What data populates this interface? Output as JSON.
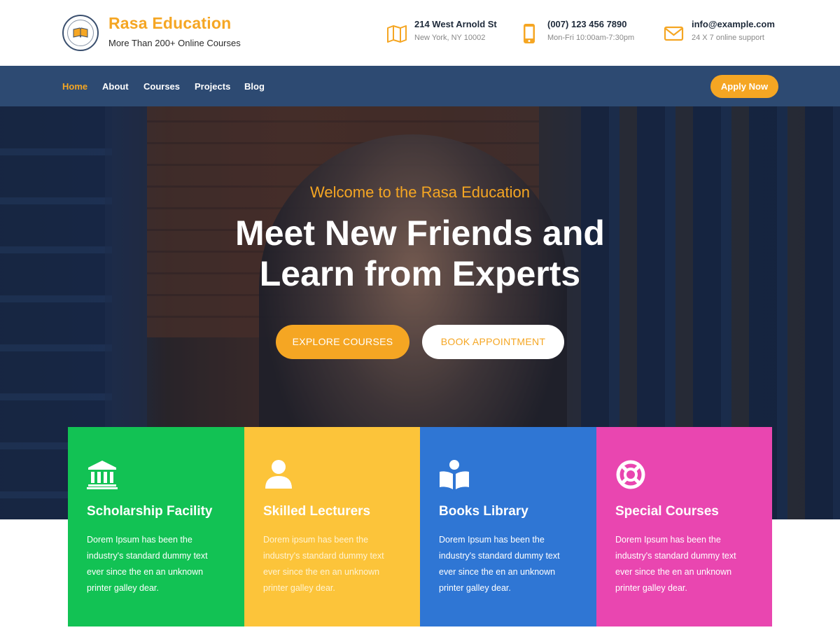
{
  "header": {
    "brand_title": "Rasa Education",
    "brand_subtitle": "More Than 200+ Online Courses",
    "logo_icon": "school-seal-logo",
    "contacts": [
      {
        "icon": "map-icon",
        "title": "214 West Arnold St",
        "subtitle": "New York, NY 10002"
      },
      {
        "icon": "phone-icon",
        "title": "(007) 123 456 7890",
        "subtitle": "Mon-Fri 10:00am-7:30pm"
      },
      {
        "icon": "mail-icon",
        "title": "info@example.com",
        "subtitle": "24 X 7 online support"
      }
    ]
  },
  "nav": {
    "items": [
      {
        "label": "Home",
        "active": true
      },
      {
        "label": "About",
        "active": false
      },
      {
        "label": "Courses",
        "active": false
      },
      {
        "label": "Projects",
        "active": false
      },
      {
        "label": "Blog",
        "active": false
      }
    ],
    "cta": "Apply Now"
  },
  "hero": {
    "kicker": "Welcome to the Rasa Education",
    "title_line1": "Meet New Friends and",
    "title_line2": "Learn from Experts",
    "primary_button": "EXPLORE COURSES",
    "secondary_button": "BOOK APPOINTMENT"
  },
  "features": [
    {
      "icon": "institution-icon",
      "title": "Scholarship Facility",
      "text": "Dorem Ipsum has been the industry's standard dummy text ever since the en an unknown printer galley dear.",
      "color": "#12c254"
    },
    {
      "icon": "user-icon",
      "title": "Skilled Lecturers",
      "text": "Dorem ipsum has been the industry's standard dummy text ever since the en an unknown printer galley dear.",
      "color": "#fcc43a"
    },
    {
      "icon": "book-reader-icon",
      "title": "Books Library",
      "text": "Dorem Ipsum has been the industry's standard dummy text ever since the en an unknown printer galley dear.",
      "color": "#2f76d4"
    },
    {
      "icon": "lifebuoy-icon",
      "title": "Special Courses",
      "text": "Dorem Ipsum has been the industry's standard dummy text ever since the en an unknown printer galley dear.",
      "color": "#e946b0"
    }
  ],
  "colors": {
    "accent": "#f5a623",
    "nav_bg": "#2d4a72",
    "dark_text": "#1e2a3a"
  }
}
